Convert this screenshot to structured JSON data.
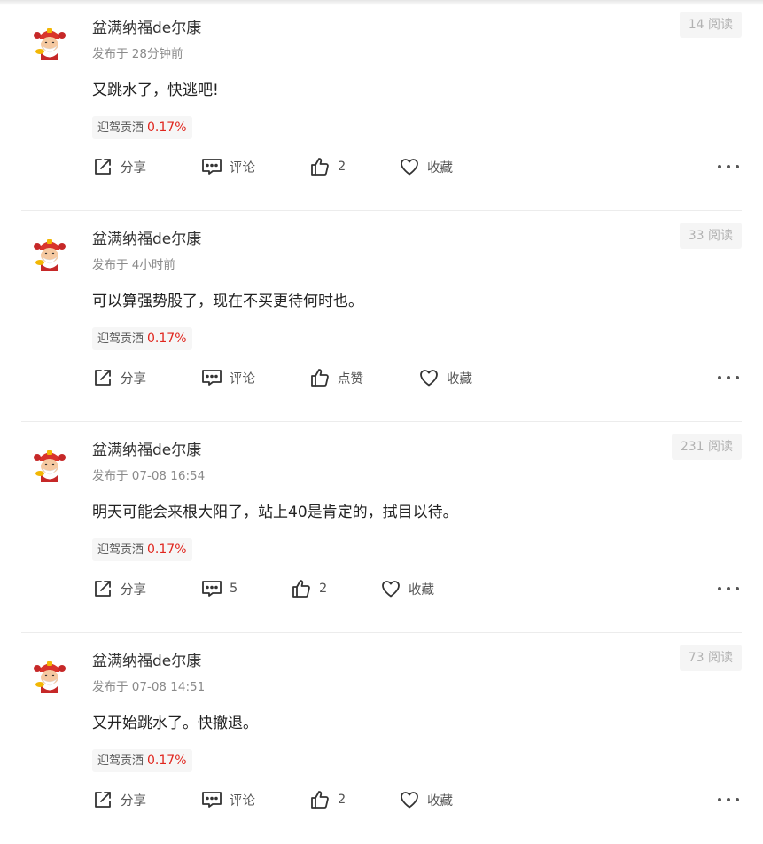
{
  "posts": [
    {
      "author": "盆满纳福de尔康",
      "time": "发布于 28分钟前",
      "reads": "14 阅读",
      "content": "又跳水了，快逃吧!",
      "stock_name": "迎驾贡酒",
      "stock_change": "0.17%",
      "share": "分享",
      "comment": "评论",
      "like": "2",
      "favorite": "收藏"
    },
    {
      "author": "盆满纳福de尔康",
      "time": "发布于 4小时前",
      "reads": "33 阅读",
      "content": "可以算强势股了，现在不买更待何时也。",
      "stock_name": "迎驾贡酒",
      "stock_change": "0.17%",
      "share": "分享",
      "comment": "评论",
      "like": "点赞",
      "favorite": "收藏"
    },
    {
      "author": "盆满纳福de尔康",
      "time": "发布于 07-08 16:54",
      "reads": "231 阅读",
      "content": "明天可能会来根大阳了，站上40是肯定的，拭目以待。",
      "stock_name": "迎驾贡酒",
      "stock_change": "0.17%",
      "share": "分享",
      "comment": "5",
      "like": "2",
      "favorite": "收藏"
    },
    {
      "author": "盆满纳福de尔康",
      "time": "发布于 07-08 14:51",
      "reads": "73 阅读",
      "content": "又开始跳水了。快撤退。",
      "stock_name": "迎驾贡酒",
      "stock_change": "0.17%",
      "share": "分享",
      "comment": "评论",
      "like": "2",
      "favorite": "收藏"
    }
  ],
  "icons": {
    "share": "share-icon",
    "comment": "comment-icon",
    "like": "thumbs-up-icon",
    "favorite": "heart-icon",
    "more": "more-icon",
    "avatar": "caishen-avatar"
  },
  "colors": {
    "accent_red": "#e0261e",
    "muted_text": "#8a8a8a",
    "divider": "#ececec"
  }
}
